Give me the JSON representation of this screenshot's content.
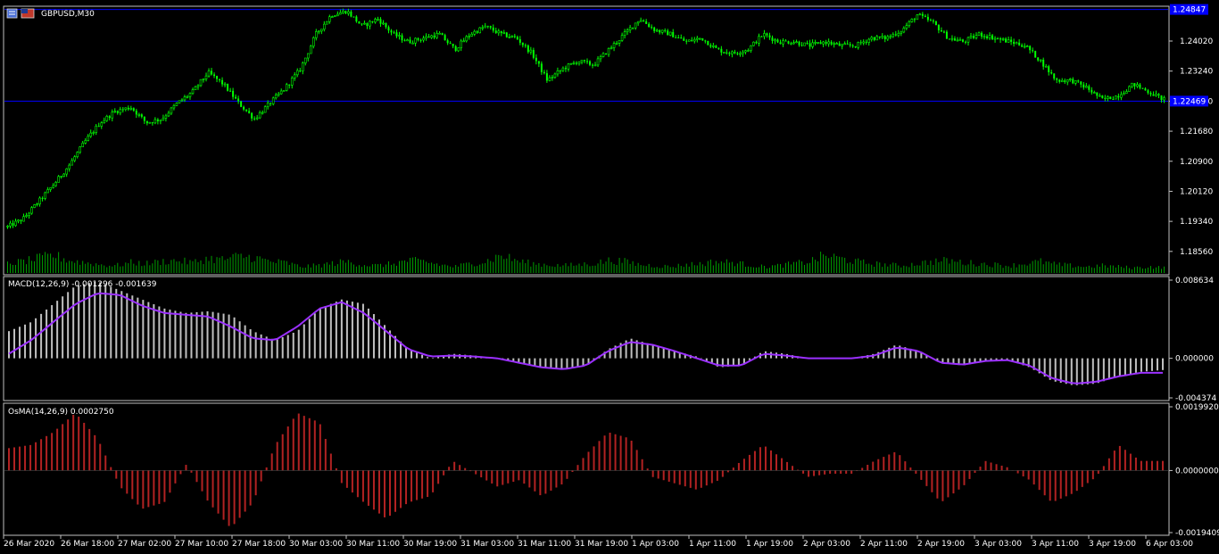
{
  "window": {
    "symbol_label": "GBPUSD,M30"
  },
  "colors": {
    "background": "#000000",
    "frame": "#c0c0c0",
    "text": "#ffffff",
    "bull": "#00ff00",
    "bear": "#00ff00",
    "volume": "#00a000",
    "hline": "#0000ff",
    "macd_hist": "#c0c0c0",
    "macd_signal": "#9b30ff",
    "osma": "#b22222",
    "tag_bg": "#0000ff"
  },
  "chart_data": [
    {
      "type": "candlestick",
      "name_label": "GBPUSD,M30",
      "ylim": [
        1.18,
        1.249
      ],
      "price_ticks": [
        "1.24020",
        "1.23240",
        "1.22460",
        "1.21680",
        "1.20900",
        "1.20120",
        "1.19340",
        "1.18560"
      ],
      "price_tick_values": [
        1.2402,
        1.2324,
        1.2246,
        1.2168,
        1.209,
        1.2012,
        1.1934,
        1.1856
      ],
      "horizontal_lines": [
        1.2484,
        1.2246
      ],
      "price_tags": [
        {
          "value": 1.2484,
          "text": "1.24847"
        },
        {
          "value": 1.2246,
          "text": "1.22469"
        }
      ],
      "candles_anchor_close": [
        1.192,
        1.194,
        1.1985,
        1.203,
        1.208,
        1.214,
        1.219,
        1.222,
        1.223,
        1.219,
        1.22,
        1.224,
        1.227,
        1.232,
        1.229,
        1.224,
        1.22,
        1.224,
        1.228,
        1.233,
        1.242,
        1.247,
        1.248,
        1.244,
        1.246,
        1.242,
        1.24,
        1.241,
        1.242,
        1.238,
        1.242,
        1.244,
        1.242,
        1.241,
        1.237,
        1.23,
        1.233,
        1.235,
        1.234,
        1.238,
        1.242,
        1.246,
        1.243,
        1.242,
        1.24,
        1.241,
        1.238,
        1.237,
        1.238,
        1.242,
        1.24,
        1.24,
        1.239,
        1.24,
        1.239,
        1.239,
        1.241,
        1.241,
        1.243,
        1.247,
        1.245,
        1.241,
        1.24,
        1.242,
        1.241,
        1.24,
        1.239,
        1.235,
        1.23,
        1.23,
        1.228,
        1.225,
        1.226,
        1.229,
        1.227,
        1.225
      ],
      "volume": [
        0.45,
        0.55,
        0.7,
        0.85,
        0.6,
        0.5,
        0.4,
        0.35,
        0.5,
        0.45,
        0.55,
        0.6,
        0.5,
        0.7,
        0.65,
        0.8,
        0.75,
        0.55,
        0.5,
        0.3,
        0.35,
        0.45,
        0.55,
        0.4,
        0.35,
        0.45,
        0.6,
        0.55,
        0.4,
        0.3,
        0.45,
        0.55,
        0.85,
        0.6,
        0.45,
        0.4,
        0.35,
        0.4,
        0.45,
        0.6,
        0.55,
        0.4,
        0.35,
        0.3,
        0.4,
        0.45,
        0.55,
        0.5,
        0.4,
        0.3,
        0.35,
        0.45,
        0.55,
        0.85,
        0.7,
        0.55,
        0.45,
        0.4,
        0.35,
        0.45,
        0.55,
        0.6,
        0.5,
        0.45,
        0.4,
        0.35,
        0.45,
        0.55,
        0.4,
        0.35,
        0.3,
        0.35,
        0.3,
        0.25,
        0.3,
        0.25
      ]
    },
    {
      "type": "bar",
      "name_label": "MACD(12,26,9) -0.001296 -0.001639",
      "ylim": [
        -0.004374,
        0.008634
      ],
      "axis_ticks": [
        "0.008634",
        "0.000000",
        "-0.004374"
      ],
      "axis_tick_values": [
        0.008634,
        0.0,
        -0.004374
      ],
      "hist_anchor": [
        0.003,
        0.004,
        0.006,
        0.008,
        0.0085,
        0.0075,
        0.0065,
        0.0055,
        0.005,
        0.0052,
        0.0048,
        0.003,
        0.002,
        0.003,
        0.0055,
        0.0065,
        0.006,
        0.0035,
        0.001,
        0.0,
        0.0005,
        0.0003,
        0.0,
        -0.0005,
        -0.001,
        -0.0012,
        -0.0008,
        0.001,
        0.0022,
        0.0015,
        0.0008,
        0.0002,
        -0.001,
        -0.0008,
        0.0008,
        0.0005,
        0.0,
        0.0,
        0.0,
        0.0005,
        0.0015,
        0.0008,
        -0.0005,
        -0.0008,
        -0.0003,
        -0.0002,
        -0.001,
        -0.0025,
        -0.003,
        -0.0028,
        -0.002,
        -0.0015,
        -0.0013
      ],
      "signal_anchor": [
        0.0005,
        0.002,
        0.004,
        0.006,
        0.0072,
        0.007,
        0.0058,
        0.005,
        0.0048,
        0.0046,
        0.0035,
        0.0022,
        0.002,
        0.0035,
        0.0055,
        0.0062,
        0.005,
        0.003,
        0.001,
        0.0002,
        0.0003,
        0.0002,
        0.0,
        -0.0005,
        -0.001,
        -0.0012,
        -0.0008,
        0.0008,
        0.0018,
        0.0015,
        0.0008,
        0.0,
        -0.0008,
        -0.0008,
        0.0005,
        0.0003,
        0.0,
        0.0,
        0.0,
        0.0003,
        0.0012,
        0.0008,
        -0.0005,
        -0.0007,
        -0.0003,
        -0.0002,
        -0.0008,
        -0.0022,
        -0.0028,
        -0.0026,
        -0.002,
        -0.0016,
        -0.0016
      ]
    },
    {
      "type": "bar",
      "name_label": "OsMA(14,26,9) 0.0002750",
      "ylim": [
        -0.0019409,
        0.001992
      ],
      "axis_ticks": [
        "0.0019920",
        "0.0000000",
        "-0.0019409"
      ],
      "axis_tick_values": [
        0.001992,
        0.0,
        -0.0019409
      ],
      "osma_anchor": [
        0.0007,
        0.0008,
        0.0012,
        0.0018,
        0.001,
        -0.0005,
        -0.0012,
        -0.001,
        0.0002,
        -0.001,
        -0.0018,
        -0.001,
        0.0008,
        0.0018,
        0.0015,
        -0.0004,
        -0.001,
        -0.0015,
        -0.001,
        -0.0008,
        0.0003,
        -0.0001,
        -0.0005,
        -0.0003,
        -0.0008,
        -0.0004,
        0.0005,
        0.0012,
        0.001,
        -0.0002,
        -0.0004,
        -0.0006,
        -0.0003,
        0.0003,
        0.0008,
        0.0003,
        -0.0002,
        -0.0001,
        -0.0001,
        0.0003,
        0.0006,
        -0.0002,
        -0.001,
        -0.0005,
        0.0003,
        0.0001,
        -0.0003,
        -0.001,
        -0.0007,
        -0.0002,
        0.0008,
        0.0003,
        0.0003
      ]
    }
  ],
  "time_labels": [
    "26 Mar 2020",
    "26 Mar 18:00",
    "27 Mar 02:00",
    "27 Mar 10:00",
    "27 Mar 18:00",
    "30 Mar 03:00",
    "30 Mar 11:00",
    "30 Mar 19:00",
    "31 Mar 03:00",
    "31 Mar 11:00",
    "31 Mar 19:00",
    "1 Apr 03:00",
    "1 Apr 11:00",
    "1 Apr 19:00",
    "2 Apr 03:00",
    "2 Apr 11:00",
    "2 Apr 19:00",
    "3 Apr 03:00",
    "3 Apr 11:00",
    "3 Apr 19:00",
    "6 Apr 03:00"
  ]
}
